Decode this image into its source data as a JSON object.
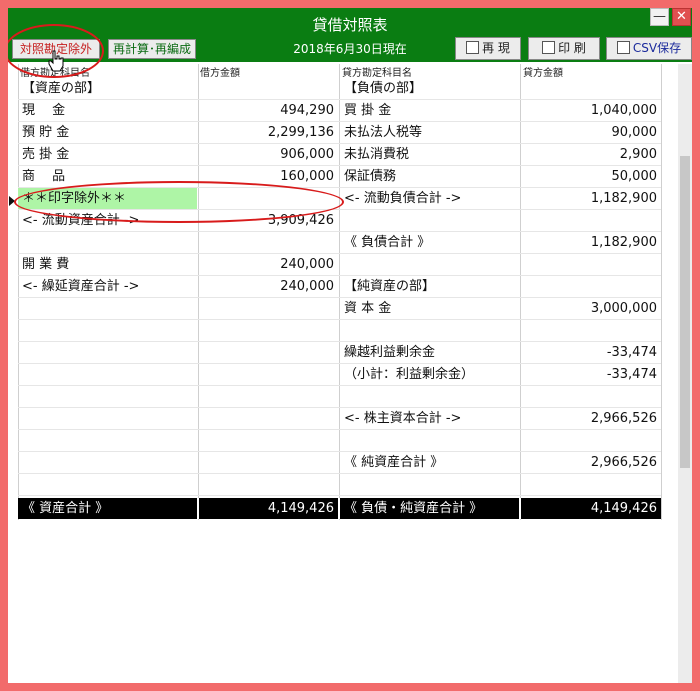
{
  "window": {
    "title": "貸借対照表",
    "date": "2018年6月30日現在",
    "minimize_label": "—",
    "close_label": "✕"
  },
  "toolbar": {
    "exclude_label": "対照勘定除外",
    "recalc_label": "再計算･再編成",
    "reproduce_label": "再 現",
    "print_label": "印 刷",
    "csv_label": "CSV保存"
  },
  "headers": {
    "debit_account": "借方勘定科目名",
    "debit_amount": "借方金額",
    "credit_account": "貸方勘定科目名",
    "credit_amount": "貸方金額"
  },
  "rows": [
    {
      "c1": "【資産の部】",
      "c2": "",
      "c3": "【負債の部】",
      "c4": ""
    },
    {
      "c1": "現　 金",
      "c2": "494,290",
      "c3": "買 掛 金",
      "c4": "1,040,000"
    },
    {
      "c1": "預 貯 金",
      "c2": "2,299,136",
      "c3": "未払法人税等",
      "c4": "90,000"
    },
    {
      "c1": "売 掛 金",
      "c2": "906,000",
      "c3": "未払消費税",
      "c4": "2,900"
    },
    {
      "c1": "商　 品",
      "c2": "160,000",
      "c3": "保証債務",
      "c4": "50,000"
    },
    {
      "c1": "＊＊印字除外＊＊",
      "c2": "",
      "c3": "<- 流動負債合計 ->",
      "c4": "1,182,900"
    },
    {
      "c1": "<- 流動資産合計 ->",
      "c2": "3,909,426",
      "c3": "",
      "c4": ""
    },
    {
      "c1": "",
      "c2": "",
      "c3": "《 負債合計 》",
      "c4": "1,182,900"
    },
    {
      "c1": "開 業 費",
      "c2": "240,000",
      "c3": "",
      "c4": ""
    },
    {
      "c1": "<- 繰延資産合計 ->",
      "c2": "240,000",
      "c3": "【純資産の部】",
      "c4": ""
    },
    {
      "c1": "",
      "c2": "",
      "c3": "資 本 金",
      "c4": "3,000,000"
    },
    {
      "c1": "",
      "c2": "",
      "c3": "",
      "c4": ""
    },
    {
      "c1": "",
      "c2": "",
      "c3": "繰越利益剰余金",
      "c4": "-33,474"
    },
    {
      "c1": "",
      "c2": "",
      "c3": "（小計：利益剰余金）",
      "c4": "-33,474"
    },
    {
      "c1": "",
      "c2": "",
      "c3": "",
      "c4": ""
    },
    {
      "c1": "",
      "c2": "",
      "c3": "<- 株主資本合計 ->",
      "c4": "2,966,526"
    },
    {
      "c1": "",
      "c2": "",
      "c3": "",
      "c4": ""
    },
    {
      "c1": "",
      "c2": "",
      "c3": "《 純資産合計 》",
      "c4": "2,966,526"
    },
    {
      "c1": "",
      "c2": "",
      "c3": "",
      "c4": ""
    }
  ],
  "totals": {
    "c1": "《 資産合計 》",
    "c2": "4,149,426",
    "c3": "《 負債・純資産合計 》",
    "c4": "4,149,426"
  },
  "colors": {
    "titlebar": "#0a7d12",
    "frame": "#f26b6b",
    "highlight_row": "#aef5a6",
    "annotation": "#d81b1b"
  }
}
